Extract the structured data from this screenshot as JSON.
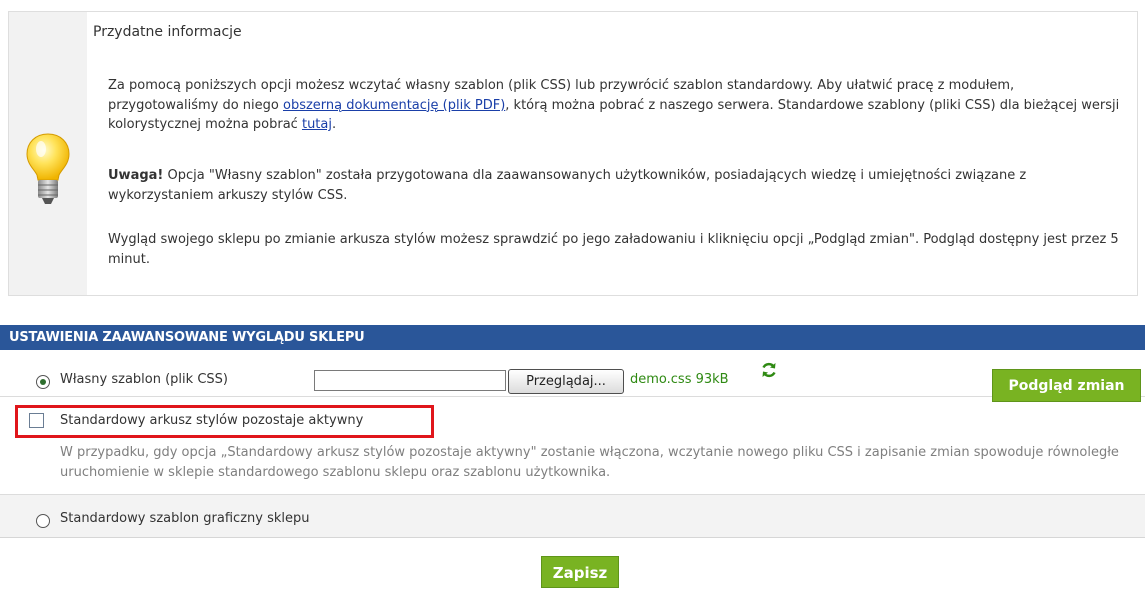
{
  "info": {
    "title": "Przydatne informacje",
    "p1_before": "Za pomocą poniższych opcji możesz wczytać własny szablon (plik CSS) lub przywrócić szablon standardowy. Aby ułatwić pracę z modułem, przygotowaliśmy do niego ",
    "p1_link_docs": "obszerną dokumentację (plik PDF)",
    "p1_middle": ", którą można pobrać z naszego serwera. Standardowe szablony (pliki CSS) dla bieżącej wersji kolorystycznej można pobrać ",
    "p1_link_here": "tutaj",
    "p1_after": ".",
    "p2_bold": "Uwaga!",
    "p2_text": " Opcja \"Własny szablon\" została przygotowana dla zaawansowanych użytkowników, posiadających wiedzę i umiejętności związane z wykorzystaniem arkuszy stylów CSS.",
    "p3_text": "Wygląd swojego sklepu po zmianie arkusza stylów możesz sprawdzić po jego załadowaniu i kliknięciu opcji „Podgląd zmian\". Podgląd dostępny jest przez 5 minut.",
    "icon": "lightbulb-icon"
  },
  "panel": {
    "header": "USTAWIENIA ZAAWANSOWANE WYGLĄDU SKLEPU",
    "custom_template_label": "Własny szablon (plik CSS)",
    "custom_template_selected": true,
    "file_input_value": "",
    "browse_label": "Przeglądaj...",
    "file_name": "demo.css 93kB",
    "refresh_icon": "refresh-icon",
    "preview_label": "Podgląd zmian",
    "keep_standard_label": "Standardowy arkusz stylów pozostaje aktywny",
    "keep_standard_checked": false,
    "note": "W przypadku, gdy opcja „Standardowy arkusz stylów pozostaje aktywny\" zostanie włączona, wczytanie nowego pliku CSS i zapisanie zmian spowoduje równoległe uruchomienie w sklepie standardowego szablonu sklepu oraz szablonu użytkownika.",
    "standard_template_label": "Standardowy szablon graficzny sklepu",
    "standard_template_selected": false
  },
  "save_label": "Zapisz",
  "colors": {
    "header_bg": "#2a5699",
    "button_green": "#79b322",
    "file_name_green": "#2f8a13",
    "highlight_red": "#e0161b",
    "link_blue": "#1a3fa8"
  }
}
